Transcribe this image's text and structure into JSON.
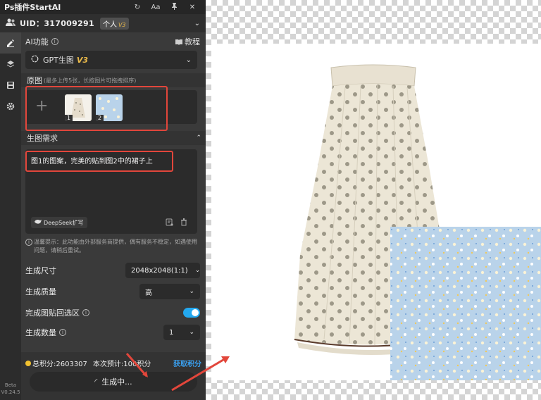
{
  "app": {
    "title": "Ps插件StartAI",
    "version": "Beta V0.24.5"
  },
  "user": {
    "uid": "UID：317009291",
    "badge": "个人",
    "badge_level": "V3"
  },
  "ai_feature": {
    "label": "AI功能",
    "tutorial": "教程",
    "selected": "GPT生图",
    "selected_tag": "V3"
  },
  "original": {
    "label": "原图",
    "hint": "(最多上传5张，长按图片可拖拽排序)",
    "thumbs": [
      {
        "num": "1"
      },
      {
        "num": "2"
      }
    ]
  },
  "prompt": {
    "label": "生图需求",
    "text": "图1的图案，完美的贴到图2中的裙子上",
    "deepseek": "DeepSeek扩写"
  },
  "notice": "温馨提示：此功能由外部服务商提供，偶有服务不稳定，如遇使用问题，请稍后重试。",
  "settings": {
    "size": {
      "label": "生成尺寸",
      "value": "2048x2048(1:1)"
    },
    "quality": {
      "label": "生成质量",
      "value": "高"
    },
    "paste_back": {
      "label": "完成图贴回选区",
      "on": true
    },
    "count": {
      "label": "生成数量",
      "value": "1"
    }
  },
  "footer": {
    "total_points": "总积分:2603307",
    "estimate": "本次预计:100积分",
    "get_points": "获取积分",
    "generate": "生成中..."
  },
  "colors": {
    "accent": "#23a8ef",
    "annotation": "#e2463b",
    "gold": "#e9b94a"
  }
}
